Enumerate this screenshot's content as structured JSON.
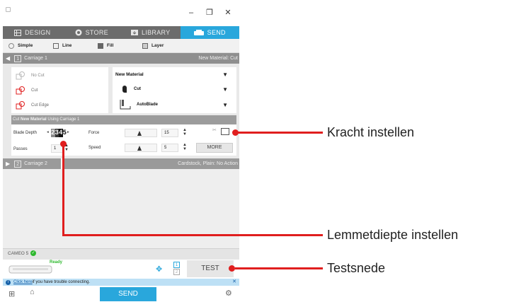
{
  "window": {
    "minimize": "–",
    "restore": "❐",
    "close": "✕"
  },
  "nav": {
    "tabs": [
      {
        "label": "DESIGN",
        "icon": "grid-icon"
      },
      {
        "label": "STORE",
        "icon": "store-icon"
      },
      {
        "label": "LIBRARY",
        "icon": "library-icon"
      },
      {
        "label": "SEND",
        "icon": "cutter-icon"
      }
    ],
    "active_tab": "SEND"
  },
  "modes": [
    "Simple",
    "Line",
    "Fill",
    "Layer"
  ],
  "carriage1": {
    "num": "1",
    "label": "Carriage 1",
    "material": "New Material: Cut"
  },
  "cut_options": [
    "No Cut",
    "Cut",
    "Cut Edge"
  ],
  "dropdowns": {
    "material": "New Material",
    "action": "Cut",
    "tool": "AutoBlade"
  },
  "settings_header": {
    "pre": "Cut ",
    "material": "New Material",
    "post": " Using Carriage 1"
  },
  "blade_depth": {
    "label": "Blade Depth",
    "digits": [
      "2",
      "3",
      "4",
      "5"
    ]
  },
  "force": {
    "label": "Force",
    "value": "15"
  },
  "passes": {
    "label": "Passes",
    "value": "1"
  },
  "speed": {
    "label": "Speed",
    "value": "5"
  },
  "more_button": "MORE",
  "carriage2": {
    "num": "2",
    "label": "Carriage 2",
    "material": "Cardstock, Plain: No Action"
  },
  "device": {
    "name": "CAMEO 5",
    "status": "Ready"
  },
  "test_button": "TEST",
  "notice": {
    "link": "Click here",
    "text": " if you have trouble connecting."
  },
  "send_button": "SEND",
  "annotations": [
    "Kracht instellen",
    "Lemmetdiepte instellen",
    "Testsnede"
  ],
  "colors": {
    "accent": "#29a7dc",
    "callout": "#e01e1e",
    "ready": "#2db82d"
  }
}
